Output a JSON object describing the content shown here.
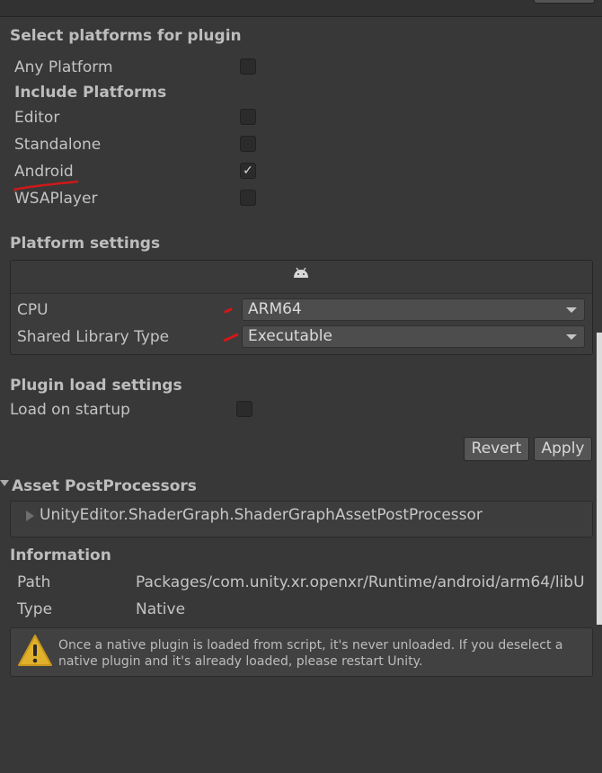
{
  "platforms": {
    "section_title": "Select platforms for plugin",
    "any_platform": {
      "label": "Any Platform",
      "checked": false
    },
    "include_title": "Include Platforms",
    "items": [
      {
        "label": "Editor",
        "checked": false
      },
      {
        "label": "Standalone",
        "checked": false
      },
      {
        "label": "Android",
        "checked": true
      },
      {
        "label": "WSAPlayer",
        "checked": false
      }
    ]
  },
  "platform_settings": {
    "section_title": "Platform settings",
    "tab_icon": "android-icon",
    "cpu": {
      "label": "CPU",
      "value": "ARM64"
    },
    "shared_lib": {
      "label": "Shared Library Type",
      "value": "Executable"
    }
  },
  "load_settings": {
    "section_title": "Plugin load settings",
    "load_on_startup": {
      "label": "Load on startup",
      "checked": false
    }
  },
  "actions": {
    "revert": "Revert",
    "apply": "Apply"
  },
  "postprocessors": {
    "section_title": "Asset PostProcessors",
    "items": [
      "UnityEditor.ShaderGraph.ShaderGraphAssetPostProcessor"
    ]
  },
  "information": {
    "section_title": "Information",
    "path_label": "Path",
    "path_value": "Packages/com.unity.xr.openxr/Runtime/android/arm64/libU",
    "type_label": "Type",
    "type_value": "Native",
    "warning_line1": "Once a native plugin is loaded from script, it's never unloaded. If you deselect a",
    "warning_line2": "native plugin and it's already loaded, please restart Unity."
  },
  "check_glyph": "✓",
  "colors": {
    "background": "#383838",
    "annotation_red": "#d01818"
  }
}
